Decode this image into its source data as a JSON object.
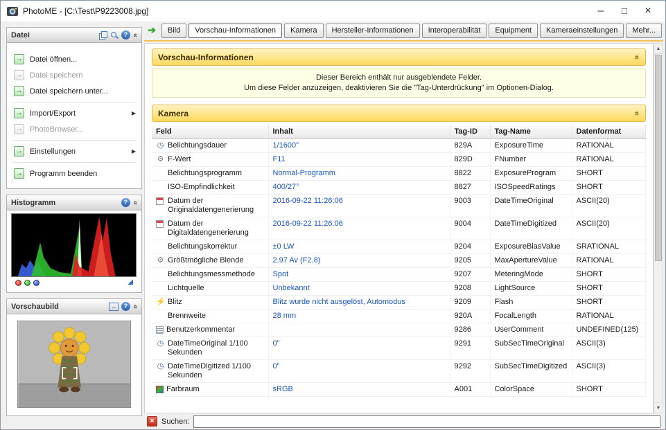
{
  "window": {
    "title": "PhotoME - [C:\\Test\\P9223008.jpg]",
    "controls": {
      "minimize": "─",
      "maximize": "□",
      "close": "×"
    }
  },
  "tabs": {
    "active_index": 1,
    "items": [
      {
        "id": "bild",
        "label": "Bild"
      },
      {
        "id": "vorschau-informationen",
        "label": "Vorschau-Informationen"
      },
      {
        "id": "kamera",
        "label": "Kamera"
      },
      {
        "id": "hersteller-informationen",
        "label": "Hersteller-Informationen"
      },
      {
        "id": "interoperabilitaet",
        "label": "Interoperabilität"
      },
      {
        "id": "equipment",
        "label": "Equipment"
      },
      {
        "id": "kameraeinstellungen",
        "label": "Kameraeinstellungen"
      },
      {
        "id": "mehr",
        "label": "Mehr..."
      }
    ]
  },
  "sidebar": {
    "datei": {
      "title": "Datei",
      "groups": [
        [
          {
            "id": "open",
            "label": "Datei öffnen...",
            "disabled": false,
            "submenu": false
          },
          {
            "id": "save",
            "label": "Datei speichern",
            "disabled": true,
            "submenu": false
          },
          {
            "id": "save-as",
            "label": "Datei speichern unter...",
            "disabled": false,
            "submenu": false
          }
        ],
        [
          {
            "id": "import-export",
            "label": "Import/Export",
            "disabled": false,
            "submenu": true
          },
          {
            "id": "photobrowser",
            "label": "PhotoBrowser...",
            "disabled": true,
            "submenu": false
          }
        ],
        [
          {
            "id": "settings",
            "label": "Einstellungen",
            "disabled": false,
            "submenu": true
          }
        ],
        [
          {
            "id": "exit",
            "label": "Programm beenden",
            "disabled": false,
            "submenu": false
          }
        ]
      ]
    },
    "histogramm": {
      "title": "Histogramm",
      "channel_toggles": [
        "red",
        "green",
        "blue"
      ]
    },
    "vorschaubild": {
      "title": "Vorschaubild"
    }
  },
  "sections": {
    "vorschau": {
      "title": "Vorschau-Informationen",
      "info_lines": [
        "Dieser Bereich enthält nur ausgeblendete Felder.",
        "Um diese Felder anzuzeigen, deaktivieren Sie die \"Tag-Unterdrückung\" im Optionen-Dialog."
      ]
    },
    "kamera": {
      "title": "Kamera"
    }
  },
  "kamera_table": {
    "columns": [
      "Feld",
      "Inhalt",
      "Tag-ID",
      "Tag-Name",
      "Datenformat"
    ],
    "rows": [
      {
        "icon": "clock",
        "feld": "Belichtungsdauer",
        "inhalt": "1/1600\"",
        "tagid": "829A",
        "tagname": "ExposureTime",
        "format": "RATIONAL"
      },
      {
        "icon": "aperture",
        "feld": "F-Wert",
        "inhalt": "F11",
        "tagid": "829D",
        "tagname": "FNumber",
        "format": "RATIONAL"
      },
      {
        "icon": "none",
        "feld": "Belichtungsprogramm",
        "inhalt": "Normal-Programm",
        "tagid": "8822",
        "tagname": "ExposureProgram",
        "format": "SHORT"
      },
      {
        "icon": "none",
        "feld": "ISO-Empfindlichkeit",
        "inhalt": "400/27°",
        "tagid": "8827",
        "tagname": "ISOSpeedRatings",
        "format": "SHORT"
      },
      {
        "icon": "calendar",
        "feld": "Datum der Originaldatengenerierung",
        "inhalt": "2016-09-22 11:26:06",
        "tagid": "9003",
        "tagname": "DateTimeOriginal",
        "format": "ASCII(20)"
      },
      {
        "icon": "calendar",
        "feld": "Datum der Digitaldatengenerierung",
        "inhalt": "2016-09-22 11:26:06",
        "tagid": "9004",
        "tagname": "DateTimeDigitized",
        "format": "ASCII(20)"
      },
      {
        "icon": "none",
        "feld": "Belichtungskorrektur",
        "inhalt": "±0 LW",
        "tagid": "9204",
        "tagname": "ExposureBiasValue",
        "format": "SRATIONAL"
      },
      {
        "icon": "aperture",
        "feld": "Größtmögliche Blende",
        "inhalt": "2.97 Av (F2.8)",
        "tagid": "9205",
        "tagname": "MaxApertureValue",
        "format": "RATIONAL"
      },
      {
        "icon": "none",
        "feld": "Belichtungsmessmethode",
        "inhalt": "Spot",
        "tagid": "9207",
        "tagname": "MeteringMode",
        "format": "SHORT"
      },
      {
        "icon": "none",
        "feld": "Lichtquelle",
        "inhalt": "Unbekannt",
        "tagid": "9208",
        "tagname": "LightSource",
        "format": "SHORT"
      },
      {
        "icon": "flash",
        "feld": "Blitz",
        "inhalt": "Blitz wurde nicht ausgelöst, Automodus",
        "tagid": "9209",
        "tagname": "Flash",
        "format": "SHORT"
      },
      {
        "icon": "none",
        "feld": "Brennweite",
        "inhalt": "28 mm",
        "tagid": "920A",
        "tagname": "FocalLength",
        "format": "RATIONAL"
      },
      {
        "icon": "comment",
        "feld": "Benutzerkommentar",
        "inhalt": "",
        "tagid": "9286",
        "tagname": "UserComment",
        "format": "UNDEFINED(125)"
      },
      {
        "icon": "clock",
        "feld": "DateTimeOriginal 1/100 Sekunden",
        "inhalt": "0\"",
        "tagid": "9291",
        "tagname": "SubSecTimeOriginal",
        "format": "ASCII(3)"
      },
      {
        "icon": "clock",
        "feld": "DateTimeDigitized 1/100 Sekunden",
        "inhalt": "0\"",
        "tagid": "9292",
        "tagname": "SubSecTimeDigitized",
        "format": "ASCII(3)"
      },
      {
        "icon": "cube",
        "feld": "Farbraum",
        "inhalt": "sRGB",
        "tagid": "A001",
        "tagname": "ColorSpace",
        "format": "SHORT"
      }
    ]
  },
  "search": {
    "label": "Suchen:",
    "value": ""
  },
  "colors": {
    "accent_yellow": "#ffd95e",
    "value_blue": "#1a56c4",
    "flash_yellow": "#e8a200"
  }
}
